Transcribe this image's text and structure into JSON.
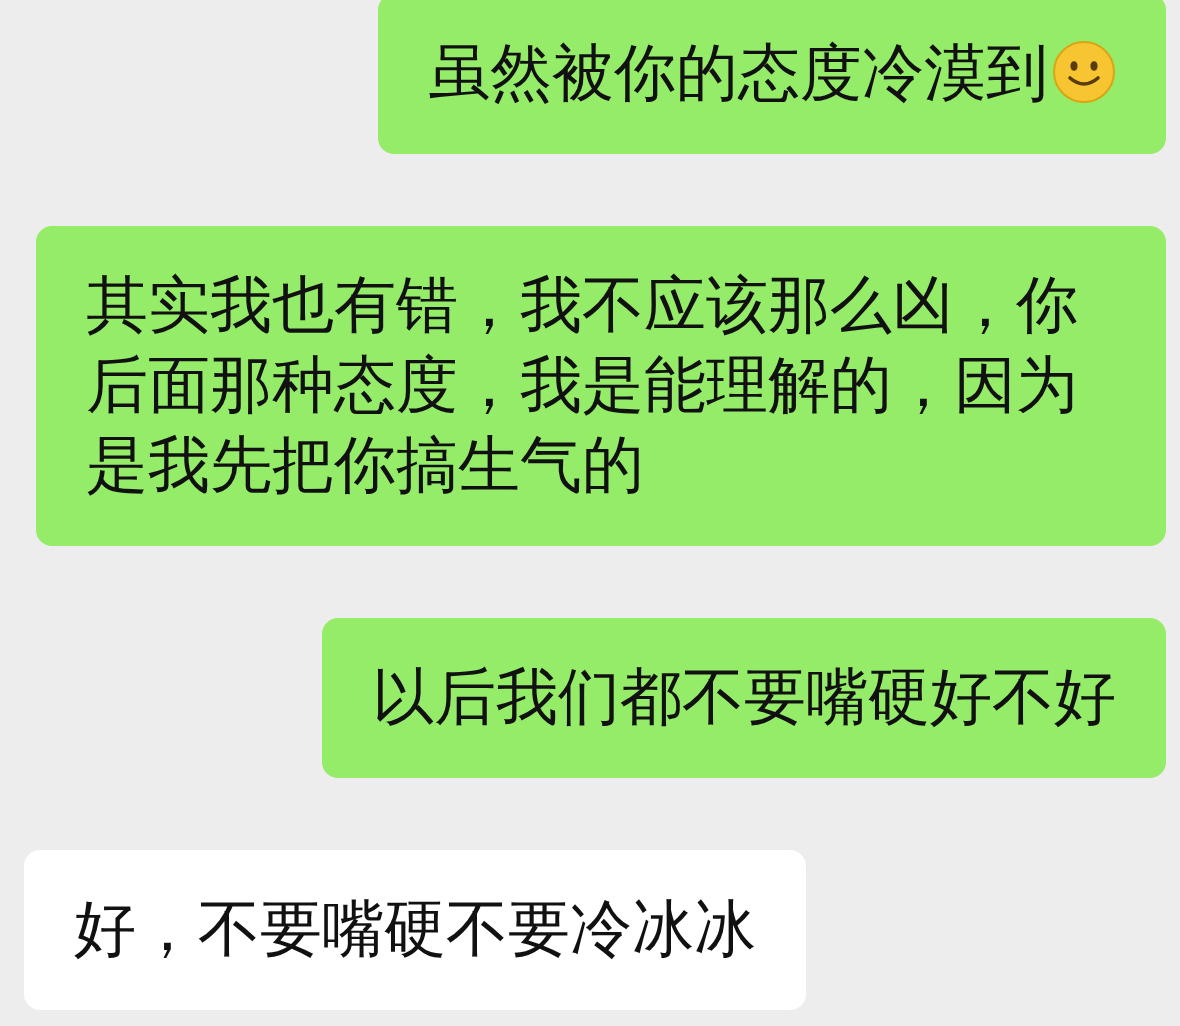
{
  "messages": [
    {
      "kind": "sent",
      "text": "虽然被你的态度冷漠到",
      "smiley": true
    },
    {
      "kind": "sent",
      "text": "其实我也有错，我不应该那么凶，你后面那种态度，我是能理解的，因为是我先把你搞生气的",
      "smiley": false
    },
    {
      "kind": "sent",
      "text": "以后我们都不要嘴硬好不好",
      "smiley": false
    },
    {
      "kind": "received",
      "text": "好，不要嘴硬不要冷冰冰",
      "smiley": false
    }
  ]
}
